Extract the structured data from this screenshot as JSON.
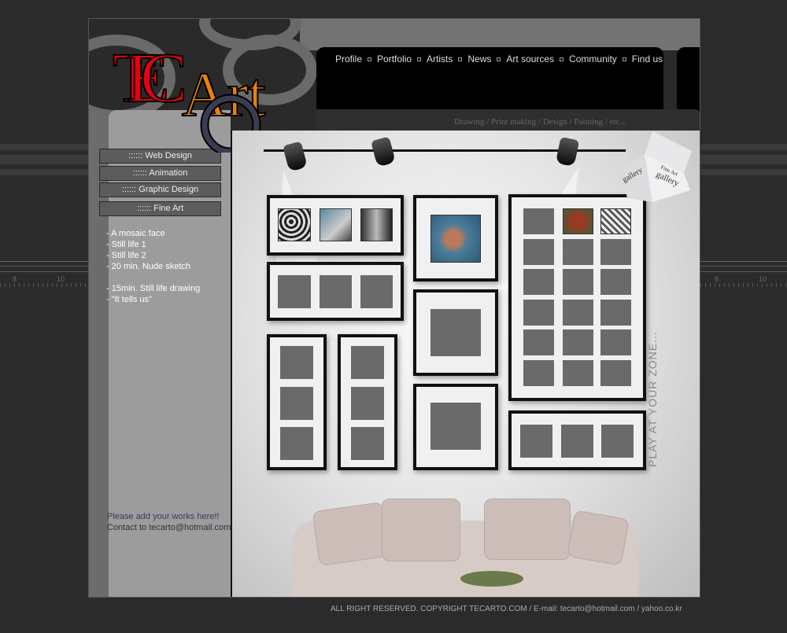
{
  "brand": {
    "logo_text": "TECArtO",
    "colors": {
      "orange": "#e8820c",
      "red": "#e80010",
      "navy": "#3a3d52"
    }
  },
  "rulers": {
    "labels": [
      "8",
      "10"
    ]
  },
  "nav": {
    "items": [
      "Profile",
      "Portfolio",
      "Artists",
      "News",
      "Art sources",
      "Community",
      "Find us"
    ]
  },
  "tagline": "Drawing / Print making / Design / Painting / etc...",
  "sidebar": {
    "menu": [
      ":::::: Web Design",
      ":::::: Animation",
      ":::::: Graphic Design",
      ":::::: Fine Art"
    ],
    "works": [
      "- A mosaic face",
      "- Still life 1",
      "- Still life 2",
      "- 20 min. Nude sketch",
      "",
      "- 15min. Still life drawing",
      "- \"It tells us\""
    ],
    "note": [
      "Please add your works here!!",
      "Contact to tecarto@hotmail.com"
    ]
  },
  "gallery": {
    "cube_text": [
      "gallery",
      "Fine Art",
      "gallery"
    ],
    "vertical_text": "PLAY AT YOUR ZONE..."
  },
  "footer": "ALL RIGHT RESERVED. COPYRIGHT  TECARTO.COM / E-mail: tecarto@hotmail.com / yahoo.co.kr"
}
